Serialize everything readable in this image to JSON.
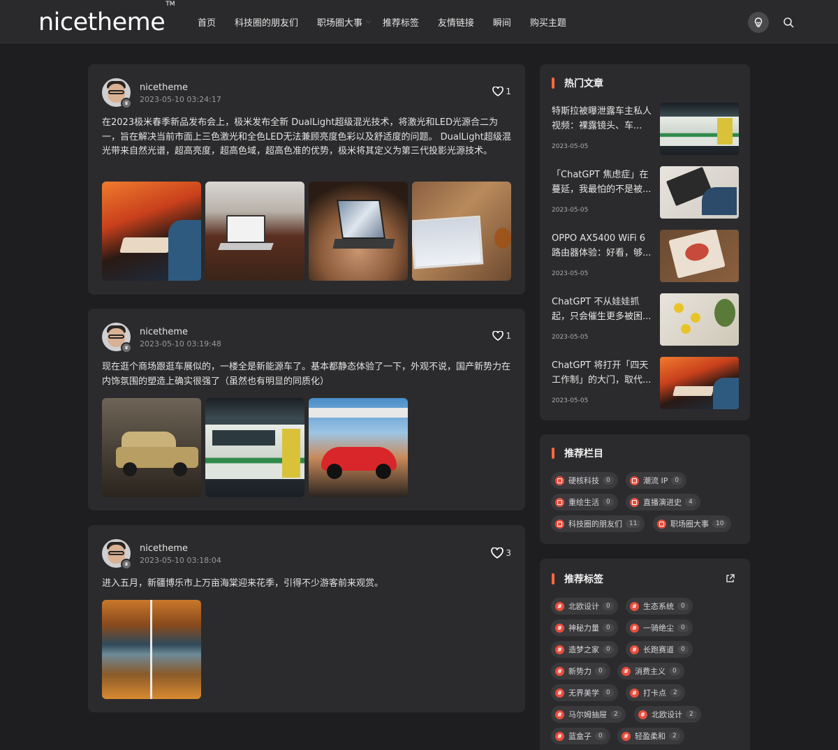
{
  "header": {
    "logo": "nicetheme",
    "logo_mark": "TM",
    "nav": [
      {
        "label": "首页"
      },
      {
        "label": "科技圈的朋友们"
      },
      {
        "label": "职场圈大事",
        "has_dropdown": true
      },
      {
        "label": "推荐标签"
      },
      {
        "label": "友情链接"
      },
      {
        "label": "瞬间"
      },
      {
        "label": "购买主题"
      }
    ],
    "icons": [
      "theme-toggle-icon",
      "search-icon"
    ]
  },
  "posts": [
    {
      "author": "nicetheme",
      "time": "2023-05-10 03:24:17",
      "likes": "1",
      "text": "在2023极米春季新品发布会上，极米发布全新 DualLight超级混光技术，将激光和LED光源合二为一，旨在解决当前市面上三色激光和全色LED无法兼顾亮度色彩以及舒适度的问题。 DualLight超级混光带来自然光谱，超高亮度，超高色域，超高色准的优势，极米将其定义为第三代投影光源技术。",
      "images": [
        "keyboard-desk-photo",
        "laptop-cafe-photo",
        "laptop-table-photo",
        "tablet-wood-photo"
      ]
    },
    {
      "author": "nicetheme",
      "time": "2023-05-10 03:19:48",
      "likes": "1",
      "text": "现在逛个商场跟逛车展似的，一楼全是新能源车了。基本都静态体验了一下，外观不说，国产新势力在内饰氛围的塑造上确实很强了（虽然也有明显的同质化）",
      "images": [
        "vintage-car-photo",
        "tram-photo",
        "red-sportscar-photo"
      ]
    },
    {
      "author": "nicetheme",
      "time": "2023-05-10 03:18:04",
      "likes": "3",
      "text": "进入五月，新疆博乐市上万亩海棠迎来花季，引得不少游客前来观赏。",
      "images": [
        "autumn-lake-photo"
      ]
    }
  ],
  "sidebar": {
    "hot": {
      "title": "热门文章",
      "items": [
        {
          "title": "特斯拉被曝泄露车主私人视频：裸露镜头、车...",
          "date": "2023-05-05"
        },
        {
          "title": "「ChatGPT 焦虑症」在蔓延，我最怕的不是被...",
          "date": "2023-05-05"
        },
        {
          "title": "OPPO AX5400 WiFi 6 路由器体验：好看，够...",
          "date": "2023-05-05"
        },
        {
          "title": "ChatGPT 不从娃娃抓起，只会催生更多被困...",
          "date": "2023-05-05"
        },
        {
          "title": "ChatGPT 将打开「四天工作制」的大门，取代...",
          "date": "2023-05-05"
        }
      ]
    },
    "columns": {
      "title": "推荐栏目",
      "items": [
        {
          "label": "硬核科技",
          "count": "0"
        },
        {
          "label": "潮流 IP",
          "count": "0"
        },
        {
          "label": "重绘生活",
          "count": "0"
        },
        {
          "label": "直播演进史",
          "count": "4"
        },
        {
          "label": "科技圈的朋友们",
          "count": "11"
        },
        {
          "label": "职场圈大事",
          "count": "10"
        }
      ]
    },
    "tags": {
      "title": "推荐标签",
      "items": [
        {
          "label": "北欧设计",
          "count": "0"
        },
        {
          "label": "生态系统",
          "count": "0"
        },
        {
          "label": "神秘力量",
          "count": "0"
        },
        {
          "label": "一骑绝尘",
          "count": "0"
        },
        {
          "label": "造梦之家",
          "count": "0"
        },
        {
          "label": "长跑赛道",
          "count": "0"
        },
        {
          "label": "新势力",
          "count": "0"
        },
        {
          "label": "消费主义",
          "count": "0"
        },
        {
          "label": "无界美学",
          "count": "0"
        },
        {
          "label": "打卡点",
          "count": "2"
        },
        {
          "label": "马尔姆抽屉",
          "count": "2"
        },
        {
          "label": "北欧设计",
          "count": "2"
        },
        {
          "label": "蓝盒子",
          "count": "0"
        },
        {
          "label": "轻盈柔和",
          "count": "2"
        }
      ]
    }
  },
  "colors": {
    "background": "#1e1e20",
    "card": "#2b2b2d",
    "accent": "#ff6a3d",
    "chip_icon": "#e84d3d"
  }
}
